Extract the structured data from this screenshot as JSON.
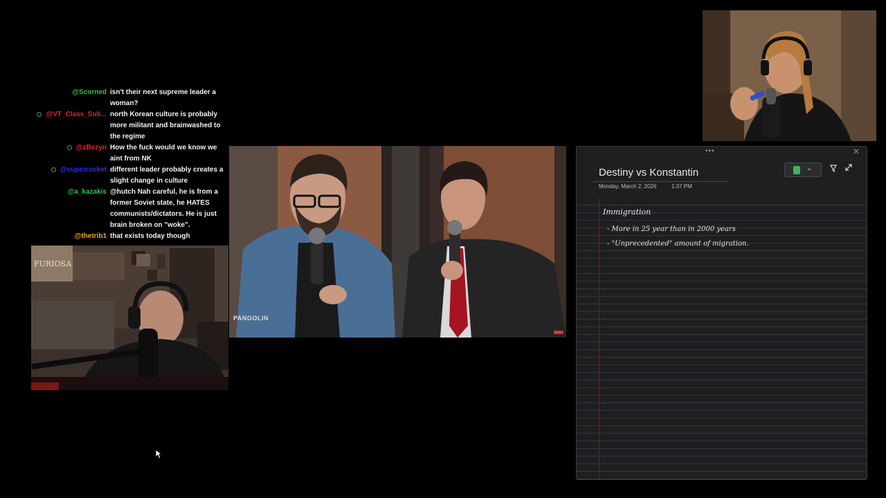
{
  "chat": [
    {
      "user": "@Scorned",
      "color": "#2ec24b",
      "badge": false,
      "text": "isn't their next supreme leader a woman?"
    },
    {
      "user": "@VT_Class_Sub...",
      "color": "#e8222e",
      "badge": true,
      "text": "north Korean culture is probably more militant and brainwashed to the regime"
    },
    {
      "user": "@zBezyn",
      "color": "#e8222e",
      "badge": true,
      "text": "How the fuck would we know we aint from NK"
    },
    {
      "user": "@superrocket",
      "color": "#2b2fe8",
      "badge": true,
      "text": "different leader probably creates a slight change in culture"
    },
    {
      "user": "@a_kazakis",
      "color": "#2ec24b",
      "badge": false,
      "text": "@hutch Nah careful, he is from a former Soviet state, he HATES communists/dictators. He is just brain broken on \"woke\"."
    },
    {
      "user": "@thetrib1",
      "color": "#e9a42a",
      "badge": false,
      "text": "that exists today though"
    }
  ],
  "video": {
    "watermark": "PANGOLIN"
  },
  "cam_left": {
    "poster_text": "FURIOSA"
  },
  "notes": {
    "title": "Destiny vs Konstantin",
    "date": "Monday, March 2, 2026",
    "time": "1:37 PM",
    "ink": {
      "heading": "Immigration",
      "line1": "- More in 25 year than in 2000 years",
      "line2": "- \"Unprecedented\" amount of migration."
    }
  },
  "icons": {
    "notebook": "notebook-icon",
    "chevron": "chevron-down-icon",
    "pin": "pin-icon",
    "expand": "expand-icon",
    "close": "close-icon",
    "drag": "drag-dots-icon",
    "cursor": "mouse-cursor-icon"
  }
}
